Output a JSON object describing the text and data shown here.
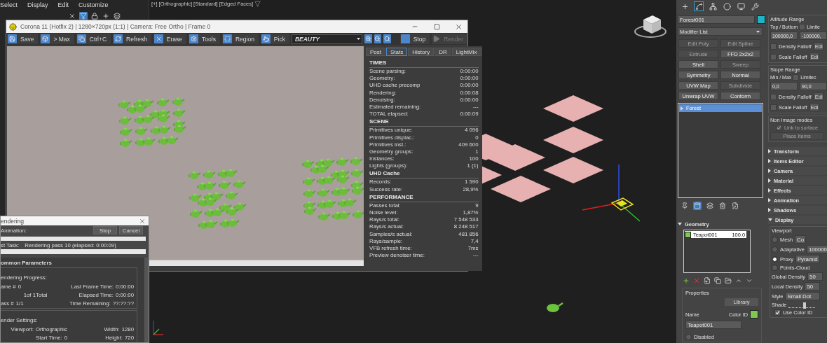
{
  "menu": [
    {
      "label": "Select"
    },
    {
      "label": "Display"
    },
    {
      "label": "Edit"
    },
    {
      "label": "Customize"
    }
  ],
  "viewport": {
    "labels": [
      "[+]",
      "[Orthographic]",
      "[Standard]",
      "[Edged Faces]"
    ]
  },
  "vfb": {
    "title": "Corona 11 (Hotfix 2) | 1280×720px (1:1) | Camera: Free Ortho | Frame 0",
    "toolbar": [
      {
        "kind": "save",
        "label": "Save"
      },
      {
        "kind": "max",
        "label": "> Max"
      },
      {
        "kind": "copy",
        "label": "Ctrl+C"
      },
      {
        "kind": "refresh",
        "label": "Refresh"
      },
      {
        "kind": "erase",
        "label": "Erase"
      },
      {
        "kind": "tools",
        "label": "Tools"
      },
      {
        "kind": "region",
        "label": "Region"
      },
      {
        "kind": "pick",
        "label": "Pick"
      }
    ],
    "channel": "BEAUTY",
    "stop": {
      "label": "Stop",
      "disabled": false
    },
    "render": {
      "label": "Render",
      "disabled": true
    },
    "tabs": [
      {
        "label": "Post",
        "selected": false
      },
      {
        "label": "Stats",
        "selected": true
      },
      {
        "label": "History",
        "selected": false
      },
      {
        "label": "DR",
        "selected": false
      },
      {
        "label": "LightMix",
        "selected": false
      }
    ],
    "stats": [
      {
        "title": "TIMES",
        "rows": [
          {
            "label": "Scene parsing:",
            "value": "0:00:00"
          },
          {
            "label": "Geometry:",
            "value": "0:00:00"
          },
          {
            "label": "UHD cache precomp",
            "value": "0:00:00"
          },
          {
            "label": "Rendering:",
            "value": "0:00:08"
          },
          {
            "label": "Denoising:",
            "value": "0:00:00"
          },
          {
            "label": "Estimated remaining:",
            "value": "---"
          },
          {
            "label": "TOTAL elapsed:",
            "value": "0:00:09"
          }
        ]
      },
      {
        "title": "SCENE",
        "rows": [
          {
            "label": "Primitives unique:",
            "value": "4 096"
          },
          {
            "label": "Primitives displac.:",
            "value": "0"
          },
          {
            "label": "Primitives inst.:",
            "value": "409 600"
          },
          {
            "label": "Geometry groups:",
            "value": "1"
          },
          {
            "label": "Instances:",
            "value": "100"
          },
          {
            "label": "Lights (groups):",
            "value": "1 (1)"
          }
        ]
      },
      {
        "title": "UHD Cache",
        "rows": [
          {
            "label": "Records:",
            "value": "1 590"
          },
          {
            "label": "Success rate:",
            "value": "28,9%"
          }
        ]
      },
      {
        "title": "PERFORMANCE",
        "rows": [
          {
            "label": "Passes total:",
            "value": "9"
          },
          {
            "label": "Noise level:",
            "value": "1,87%"
          },
          {
            "label": "Rays/s total:",
            "value": "7 548 533"
          },
          {
            "label": "Rays/s actual:",
            "value": "8 248 517"
          },
          {
            "label": "Samples/s actual:",
            "value": "481 856"
          },
          {
            "label": "Rays/sample:",
            "value": "7,4"
          },
          {
            "label": "VFB refresh time:",
            "value": "7ms"
          },
          {
            "label": "Preview denoiser time:",
            "value": "---"
          }
        ]
      }
    ]
  },
  "render_dialog": {
    "title": "endering",
    "animation_label": "Animation:",
    "buttons": [
      "Stop",
      "Cancel"
    ],
    "animation_progress": {
      "level": 0
    },
    "task_label": "st Task:",
    "task_progress": {
      "level": 0
    },
    "task": "Rendering pass 10 (elapsed: 0:00:09)",
    "section": "ommon Parameters",
    "progress_group": "endering Progress:",
    "progress_left": [
      {
        "label": "ame #",
        "value": "0"
      },
      {
        "value": "1of 1"
      },
      {
        "label": "ass #",
        "value": "1/1"
      }
    ],
    "total": "Total",
    "progress_right": [
      {
        "label": "Last Frame Time:",
        "value": "0:00:00"
      },
      {
        "label": "Elapsed Time:",
        "value": "0:00:00"
      },
      {
        "label": "Time Remaining:",
        "value": "??:??:??"
      }
    ],
    "settings_group": "ender Settings:",
    "settings": [
      {
        "label": "Viewport:",
        "value": "Orthographic"
      },
      {
        "label": "Width:",
        "value": "1280"
      },
      {
        "label": "Start Time:",
        "value": "0"
      },
      {
        "label": "Height:",
        "value": "720"
      }
    ]
  },
  "command_panel": {
    "tabs": [
      {
        "kind": "create",
        "selected": false
      },
      {
        "kind": "modify",
        "selected": true
      },
      {
        "kind": "hierarchy",
        "selected": false
      },
      {
        "kind": "motion",
        "selected": false
      },
      {
        "kind": "display",
        "selected": false
      },
      {
        "kind": "utilities",
        "selected": false
      }
    ],
    "object_name": "Forest001",
    "modifier_list": "Modifier List",
    "modifiers": [
      {
        "label": "Edit Poly",
        "disabled": true
      },
      {
        "label": "Edit Spline",
        "disabled": true
      },
      {
        "label": "Extrude",
        "disabled": true
      },
      {
        "label": "FFD 2x2x2",
        "disabled": false
      },
      {
        "label": "Shell",
        "disabled": false
      },
      {
        "label": "Sweep",
        "disabled": true
      },
      {
        "label": "Symmetry",
        "disabled": false
      },
      {
        "label": "Normal",
        "disabled": false
      },
      {
        "label": "UVW Map",
        "disabled": false
      },
      {
        "label": "Subdivide",
        "disabled": true
      },
      {
        "label": "Unwrap UVW",
        "disabled": false
      },
      {
        "label": "Conform",
        "disabled": false
      }
    ],
    "stack": [
      {
        "label": "Forest",
        "selected": true
      }
    ],
    "altitude": {
      "title": "Altitude Range",
      "label": "Top / Bottom",
      "limit": {
        "label": "Limite",
        "checked": false
      },
      "first": "100000,0",
      "second": "-100000,",
      "falloffs": [
        {
          "label": "Density Falloff",
          "checked": false,
          "button": "Edi"
        },
        {
          "label": "Scale Falloff",
          "checked": false,
          "button": "Edi"
        }
      ]
    },
    "slope": {
      "title": "Slope Range",
      "label": "Min / Max",
      "limit": {
        "label": "Limitec",
        "checked": false
      },
      "first": "0,0",
      "second": "90,0",
      "falloffs": [
        {
          "label": "Density Falloff",
          "checked": false,
          "button": "Edi"
        },
        {
          "label": "Scale Falloff",
          "checked": false,
          "button": "Edi"
        }
      ]
    },
    "non_image": {
      "title": "Non Image modes",
      "link": {
        "label": "Link to surface",
        "checked": true,
        "disabled": true
      },
      "place": {
        "label": "Place Items",
        "disabled": true
      }
    },
    "geometry": {
      "title": "Geometry",
      "expanded": true,
      "items": [
        {
          "name": "Teapot001",
          "value": "100.0",
          "color": "#7ec850"
        }
      ],
      "properties": "Properties",
      "library": "Library",
      "name_label": "Name",
      "color_label": "Color ID",
      "name_value": "Teapot001",
      "disabled": {
        "label": "Disabled",
        "selected": false
      }
    },
    "rollouts": [
      {
        "label": "Transform",
        "expanded": false
      },
      {
        "label": "Items Editor",
        "expanded": false
      },
      {
        "label": "Camera",
        "expanded": false
      },
      {
        "label": "Material",
        "expanded": false
      },
      {
        "label": "Effects",
        "expanded": false
      },
      {
        "label": "Animation",
        "expanded": false
      },
      {
        "label": "Shadows",
        "expanded": false
      },
      {
        "label": "Display",
        "expanded": true
      }
    ],
    "display": {
      "group": "Viewport",
      "modes": [
        {
          "label": "Mesh",
          "selected": false,
          "extra": "Co"
        },
        {
          "label": "Adaptative",
          "selected": false,
          "extra": "100000"
        },
        {
          "label": "Proxy",
          "selected": true,
          "extra": "Pyramid"
        },
        {
          "label": "Points-Cloud",
          "selected": false
        }
      ],
      "densities": [
        {
          "label": "Global Density",
          "value": "50"
        },
        {
          "label": "Local Density",
          "value": "50"
        }
      ],
      "style_label": "Style",
      "style": "Small Dot",
      "shade_label": "Shade",
      "shade": {
        "level": 0.62
      },
      "use_color": {
        "label": "Use Color ID",
        "checked": true
      }
    }
  }
}
